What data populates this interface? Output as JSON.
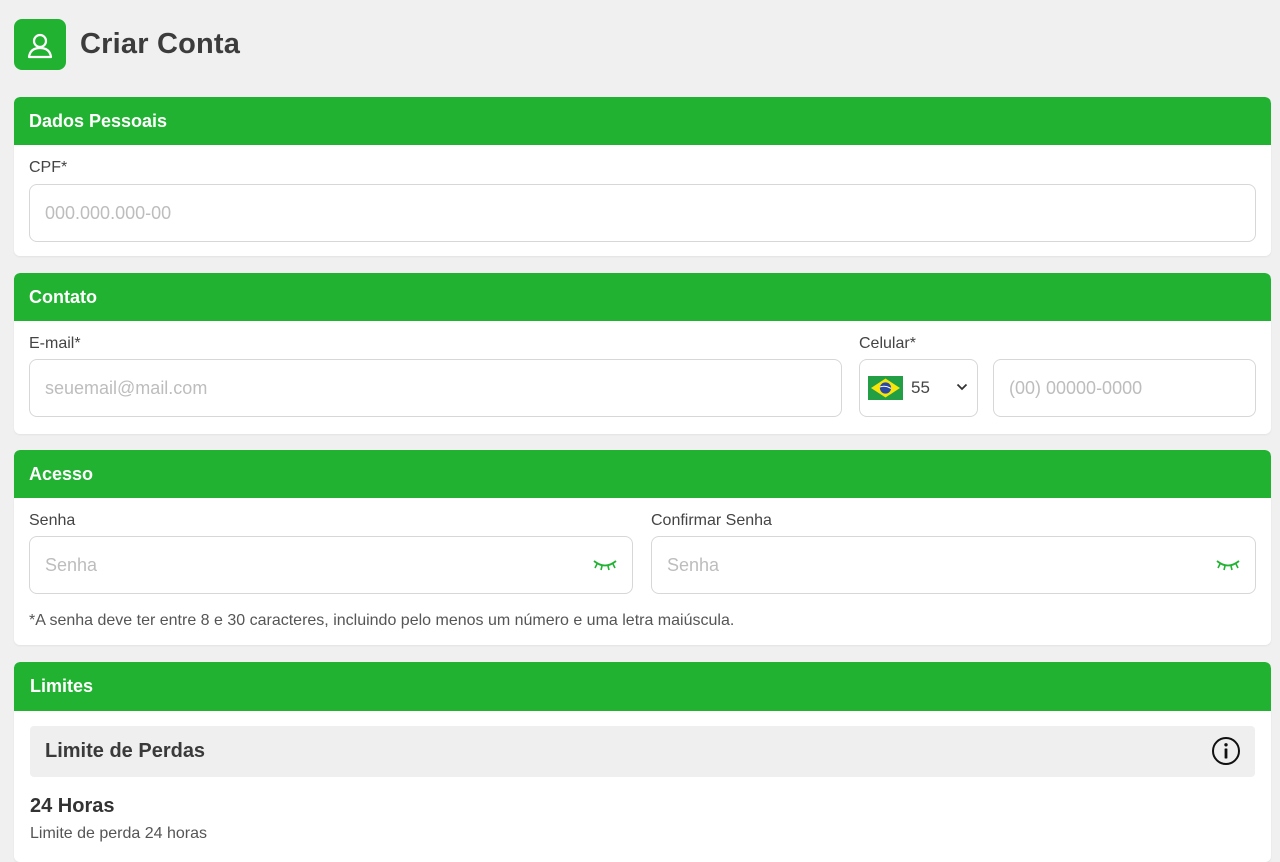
{
  "header": {
    "title": "Criar Conta",
    "icon": "user-icon"
  },
  "colors": {
    "brand_green": "#22b232",
    "page_bg": "#f0f0f0"
  },
  "personal": {
    "title": "Dados Pessoais",
    "cpf_label": "CPF*",
    "cpf_placeholder": "000.000.000-00"
  },
  "contact": {
    "title": "Contato",
    "email_label": "E-mail*",
    "email_placeholder": "seuemail@mail.com",
    "phone_label": "Celular*",
    "country_code": "55",
    "country_flag": "brazil-flag-icon",
    "phone_placeholder": "(00) 00000-0000"
  },
  "access": {
    "title": "Acesso",
    "password_label": "Senha",
    "password_placeholder": "Senha",
    "confirm_label": "Confirmar Senha",
    "confirm_placeholder": "Senha",
    "hint": "*A senha deve ter entre 8 e 30 caracteres, incluindo pelo menos um número e uma letra maiúscula."
  },
  "limits": {
    "title": "Limites",
    "loss_limit_title": "Limite de Perdas",
    "period_title": "24 Horas",
    "period_subtitle": "Limite de perda 24 horas"
  }
}
